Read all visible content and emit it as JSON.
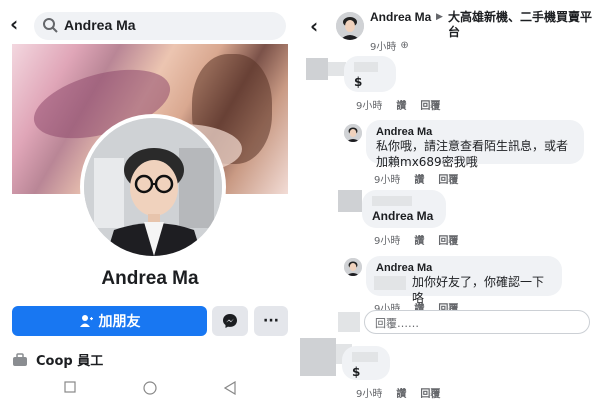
{
  "left": {
    "search_text": "Andrea Ma",
    "profile_name": "Andrea Ma",
    "add_friend_label": "加朋友",
    "more_label": "···",
    "work_text": "Coop 員工"
  },
  "right": {
    "post_author": "Andrea Ma",
    "post_group": "大高雄新機、二手機買賣平台",
    "post_time": "9小時",
    "comments": [
      {
        "author": "",
        "body": "$",
        "time": "9小時",
        "like": "讚",
        "reply": "回覆"
      },
      {
        "author": "Andrea Ma",
        "body": "私你哦，請注意查看陌生訊息，或者加賴mx689密我哦",
        "time": "9小時",
        "like": "讚",
        "reply": "回覆"
      },
      {
        "author": "",
        "body": "Andrea Ma",
        "time": "9小時",
        "like": "讚",
        "reply": "回覆"
      },
      {
        "author": "Andrea Ma",
        "body": "加你好友了，你確認一下咯",
        "time": "9小時",
        "like": "讚",
        "reply": "回覆"
      },
      {
        "author": "",
        "body": "$",
        "time": "9小時",
        "like": "讚",
        "reply": "回覆"
      }
    ],
    "reply_placeholder": "回覆……"
  },
  "colors": {
    "accent": "#1877f2",
    "bubble": "#f0f2f5",
    "muted": "#65676b"
  }
}
